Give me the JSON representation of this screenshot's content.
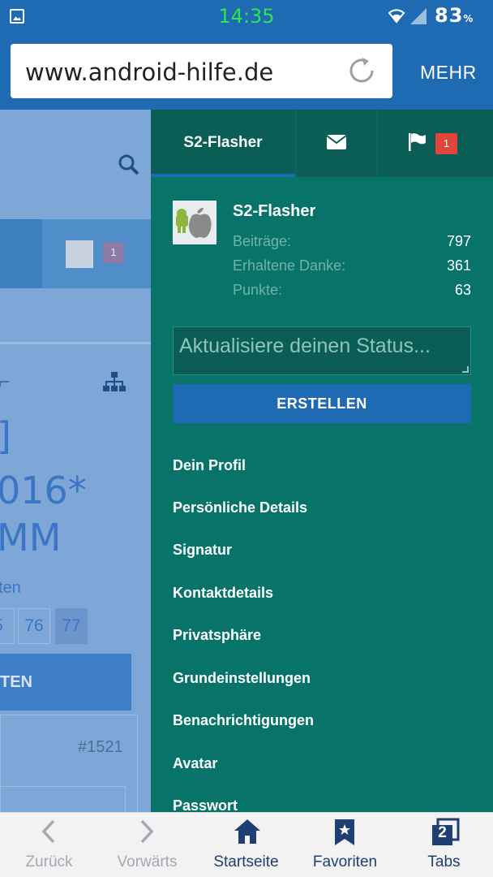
{
  "status_bar": {
    "time": "14:35",
    "battery": "83",
    "battery_unit": "%"
  },
  "browser": {
    "url": "www.android-hilfe.de",
    "more_label": "MEHR"
  },
  "background_page": {
    "badge_count": "1",
    "title_lines": [
      "]",
      "016*",
      "MM"
    ],
    "subtitle_fragment": "ten",
    "pagination": [
      "5",
      "76",
      "77"
    ],
    "button_fragment": "TEN",
    "post_number": "#1521"
  },
  "drawer": {
    "tabs": {
      "user_label": "S2-Flasher",
      "notification_count": "1"
    },
    "profile": {
      "name": "S2-Flasher",
      "stats": [
        {
          "label": "Beiträge:",
          "value": "797"
        },
        {
          "label": "Erhaltene Danke:",
          "value": "361"
        },
        {
          "label": "Punkte:",
          "value": "63"
        }
      ]
    },
    "status_placeholder": "Aktualisiere deinen Status...",
    "create_label": "ERSTELLEN",
    "menu": [
      "Dein Profil",
      "Persönliche Details",
      "Signatur",
      "Kontaktdetails",
      "Privatsphäre",
      "Grundeinstellungen",
      "Benachrichtigungen",
      "Avatar",
      "Passwort"
    ]
  },
  "bottom_nav": {
    "back": "Zurück",
    "forward": "Vorwärts",
    "home": "Startseite",
    "favorites": "Favoriten",
    "tabs": "Tabs",
    "tab_count": "2"
  },
  "colors": {
    "browser_blue": "#1f6bb3",
    "drawer_teal": "#087469",
    "tab_teal_dark": "#0a5e55",
    "badge_red": "#e0443a"
  }
}
